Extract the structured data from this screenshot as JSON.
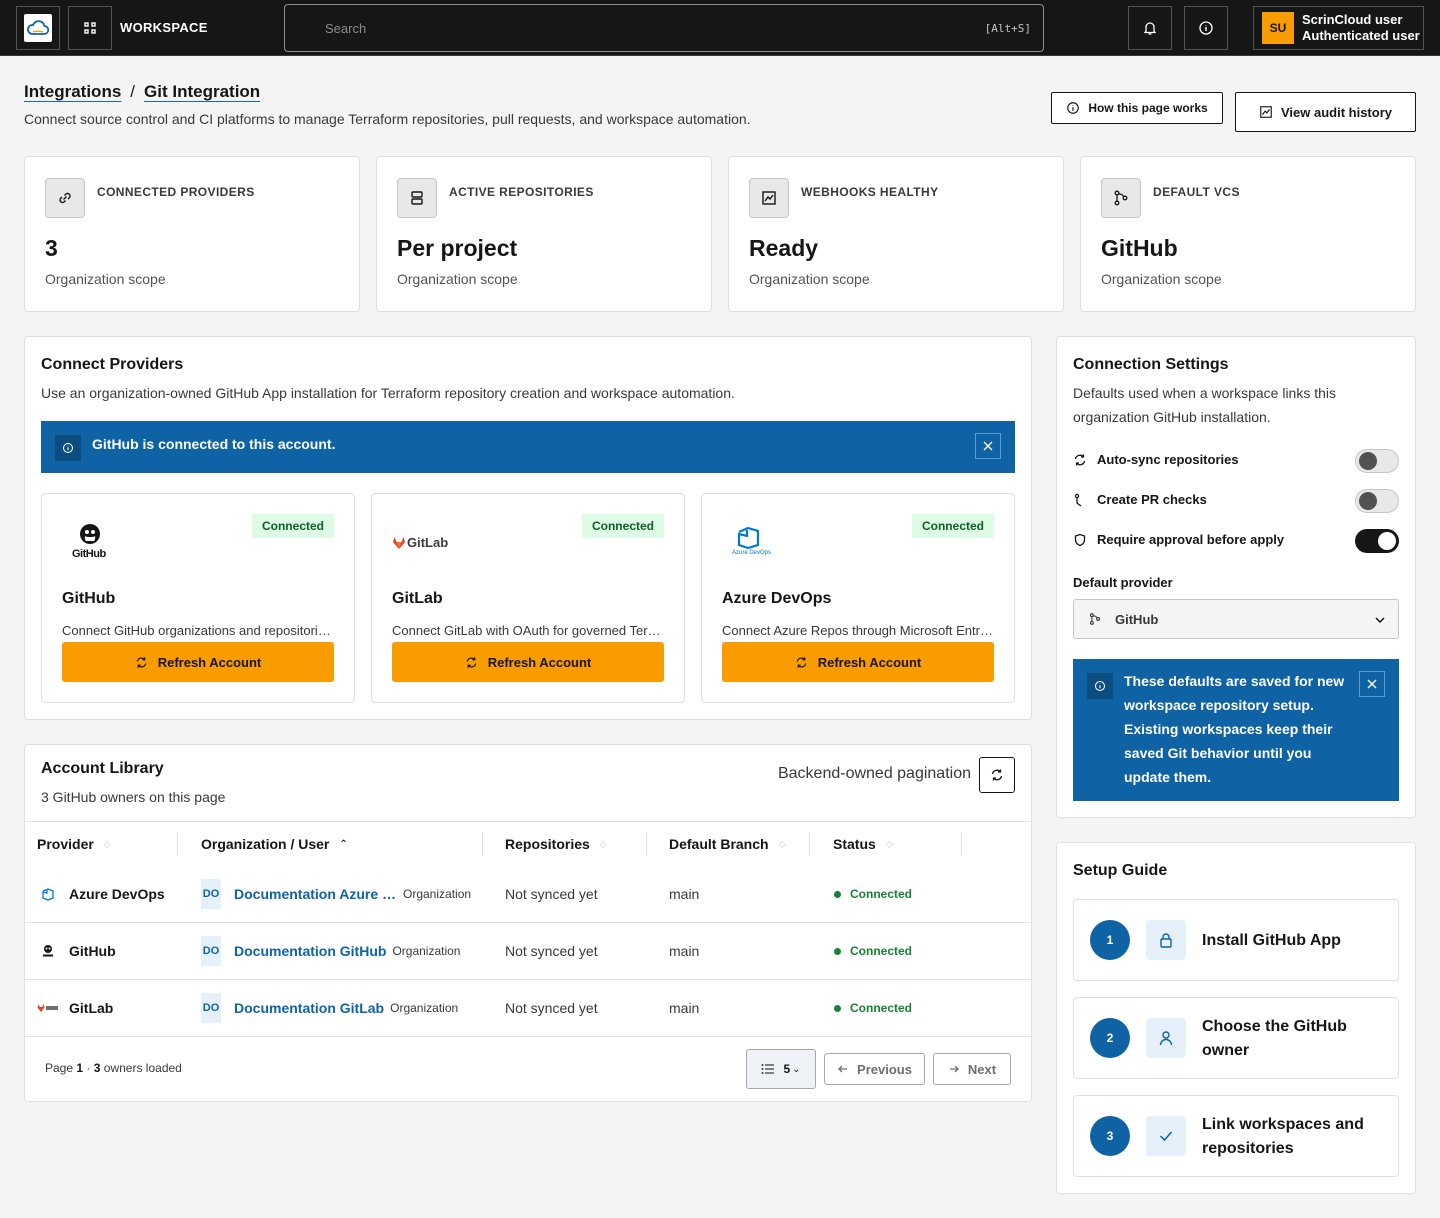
{
  "header": {
    "workspace_label": "WORKSPACE",
    "search_placeholder": "Search",
    "search_shortcut": "[Alt+S]",
    "user_initials": "SU",
    "user_name": "ScrinCloud user",
    "user_role": "Authenticated user"
  },
  "page": {
    "breadcrumb": [
      "Integrations",
      "Git Integration"
    ],
    "subtitle": "Connect source control and CI platforms to manage Terraform repositories, pull requests, and workspace automation.",
    "how_button": "How this page works",
    "audit_button": "View audit history"
  },
  "stats": [
    {
      "label": "CONNECTED PROVIDERS",
      "value": "3",
      "scope": "Organization scope",
      "icon": "link-icon"
    },
    {
      "label": "ACTIVE REPOSITORIES",
      "value": "Per project",
      "scope": "Organization scope",
      "icon": "server-icon"
    },
    {
      "label": "WEBHOOKS HEALTHY",
      "value": "Ready",
      "scope": "Organization scope",
      "icon": "activity-icon"
    },
    {
      "label": "DEFAULT VCS",
      "value": "GitHub",
      "scope": "Organization scope",
      "icon": "branch-icon"
    }
  ],
  "connect": {
    "title": "Connect Providers",
    "description": "Use an organization-owned GitHub App installation for Terraform repository creation and workspace automation.",
    "banner": "GitHub is connected to this account.",
    "providers": [
      {
        "name": "GitHub",
        "status": "Connected",
        "description": "Connect GitHub organizations and repositories with a GitHub App installation.",
        "button": "Refresh Account",
        "logo_text": "GitHub"
      },
      {
        "name": "GitLab",
        "status": "Connected",
        "description": "Connect GitLab with OAuth for governed Terraform repository access.",
        "button": "Refresh Account",
        "logo_text": "GitLab"
      },
      {
        "name": "Azure DevOps",
        "status": "Connected",
        "description": "Connect Azure Repos through Microsoft Entra ID application access.",
        "button": "Refresh Account",
        "logo_text": "Azure DevOps"
      }
    ]
  },
  "library": {
    "title": "Account Library",
    "subtitle": "3 GitHub owners on this page",
    "pagination_label": "Backend-owned pagination",
    "columns": [
      "Provider",
      "Organization / User",
      "Repositories",
      "Default Branch",
      "Status"
    ],
    "rows": [
      {
        "provider": "Azure DevOps",
        "badge": "DO",
        "org": "Documentation Azure DevOps",
        "type": "Organization",
        "repos": "Not synced yet",
        "branch": "main",
        "status": "Connected"
      },
      {
        "provider": "GitHub",
        "badge": "DO",
        "org": "Documentation GitHub",
        "type": "Organization",
        "repos": "Not synced yet",
        "branch": "main",
        "status": "Connected"
      },
      {
        "provider": "GitLab",
        "badge": "DO",
        "org": "Documentation GitLab",
        "type": "Organization",
        "repos": "Not synced yet",
        "branch": "main",
        "status": "Connected"
      }
    ],
    "footer": {
      "page_word": "Page",
      "page": "1",
      "dot": "·",
      "count": "3",
      "loaded": "owners loaded"
    },
    "page_size": "5",
    "prev": "Previous",
    "next": "Next"
  },
  "settings": {
    "title": "Connection Settings",
    "description": "Defaults used when a workspace links this organization GitHub installation.",
    "options": [
      {
        "label": "Auto-sync repositories",
        "on": false,
        "icon": "sync-icon"
      },
      {
        "label": "Create PR checks",
        "on": false,
        "icon": "pull-request-icon"
      },
      {
        "label": "Require approval before apply",
        "on": true,
        "icon": "shield-icon"
      }
    ],
    "default_provider_label": "Default provider",
    "default_provider_value": "GitHub",
    "info": "These defaults are saved for new workspace repository setup. Existing workspaces keep their saved Git behavior until you update them."
  },
  "guide": {
    "title": "Setup Guide",
    "steps": [
      {
        "num": "1",
        "label": "Install GitHub App",
        "icon": "lock-icon"
      },
      {
        "num": "2",
        "label": "Choose the GitHub owner",
        "icon": "user-icon"
      },
      {
        "num": "3",
        "label": "Link workspaces and repositories",
        "icon": "check-icon"
      }
    ]
  },
  "colors": {
    "accent": "#f99c00",
    "info_blue": "#0f62a3",
    "success": "#198038",
    "topbar": "#161616"
  }
}
